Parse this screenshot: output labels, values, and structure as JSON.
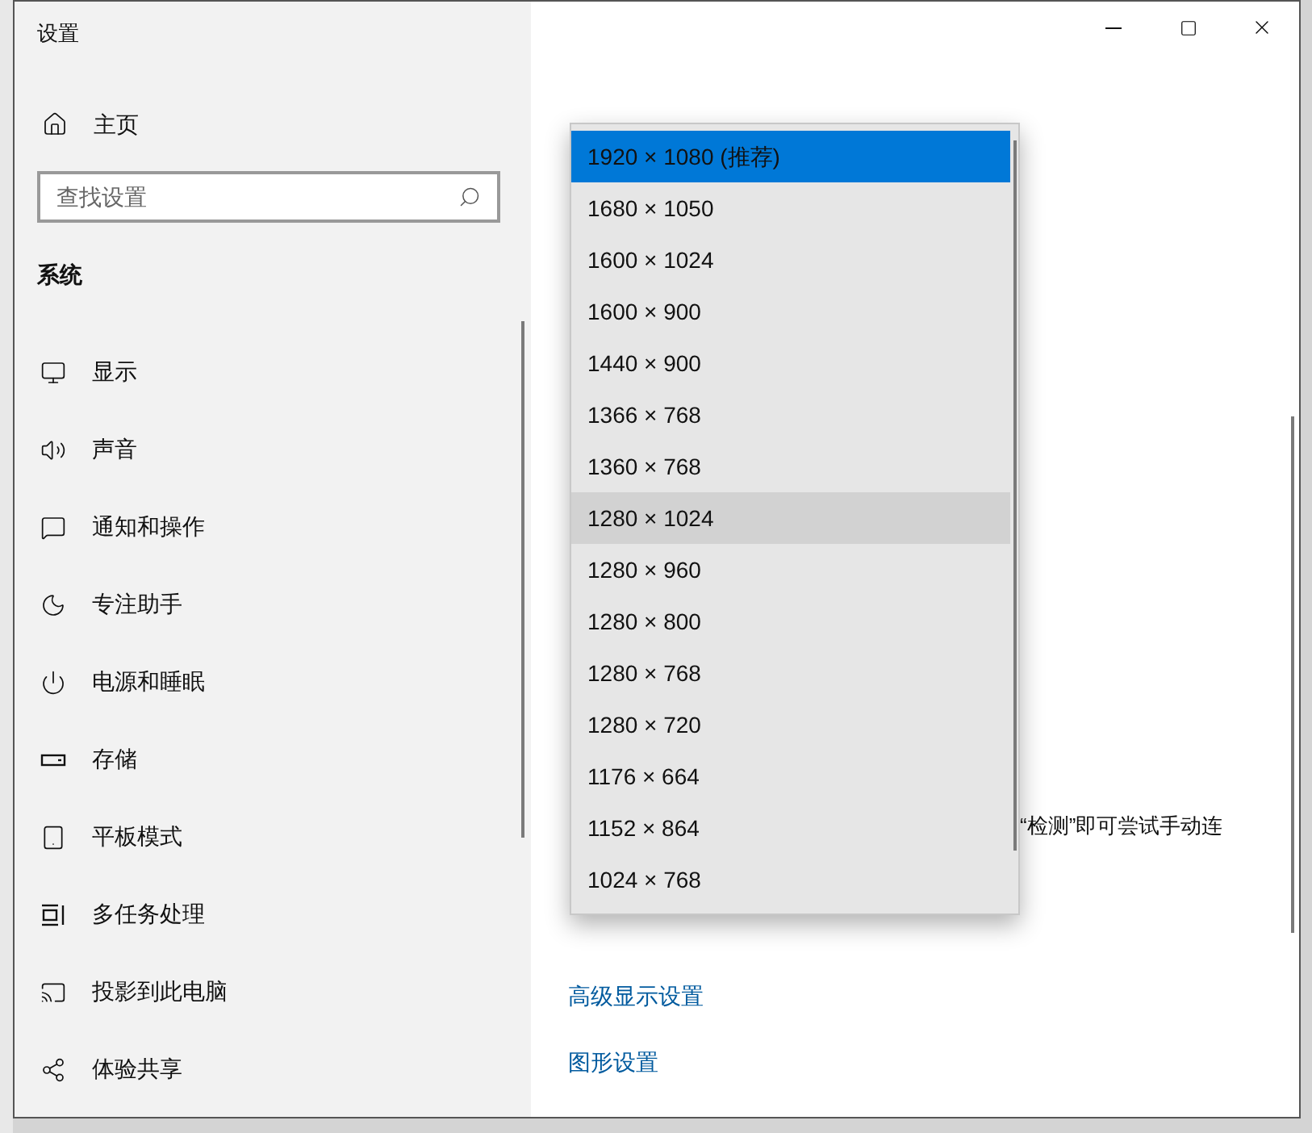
{
  "window": {
    "title": "设置"
  },
  "sidebar": {
    "home": "主页",
    "search": {
      "placeholder": "查找设置"
    },
    "section": "系统",
    "items": [
      {
        "label": "显示"
      },
      {
        "label": "声音"
      },
      {
        "label": "通知和操作"
      },
      {
        "label": "专注助手"
      },
      {
        "label": "电源和睡眠"
      },
      {
        "label": "存储"
      },
      {
        "label": "平板模式"
      },
      {
        "label": "多任务处理"
      },
      {
        "label": "投影到此电脑"
      },
      {
        "label": "体验共享"
      }
    ]
  },
  "main": {
    "partial_text": "“检测”即可尝试手动连",
    "links": [
      "高级显示设置",
      "图形设置"
    ]
  },
  "resolution_dropdown": {
    "options": [
      {
        "label": "1920 × 1080 (推荐)",
        "selected": true,
        "hovered": false
      },
      {
        "label": "1680 × 1050",
        "selected": false,
        "hovered": false
      },
      {
        "label": "1600 × 1024",
        "selected": false,
        "hovered": false
      },
      {
        "label": "1600 × 900",
        "selected": false,
        "hovered": false
      },
      {
        "label": "1440 × 900",
        "selected": false,
        "hovered": false
      },
      {
        "label": "1366 × 768",
        "selected": false,
        "hovered": false
      },
      {
        "label": "1360 × 768",
        "selected": false,
        "hovered": false
      },
      {
        "label": "1280 × 1024",
        "selected": false,
        "hovered": true
      },
      {
        "label": "1280 × 960",
        "selected": false,
        "hovered": false
      },
      {
        "label": "1280 × 800",
        "selected": false,
        "hovered": false
      },
      {
        "label": "1280 × 768",
        "selected": false,
        "hovered": false
      },
      {
        "label": "1280 × 720",
        "selected": false,
        "hovered": false
      },
      {
        "label": "1176 × 664",
        "selected": false,
        "hovered": false
      },
      {
        "label": "1152 × 864",
        "selected": false,
        "hovered": false
      },
      {
        "label": "1024 × 768",
        "selected": false,
        "hovered": false
      }
    ]
  }
}
